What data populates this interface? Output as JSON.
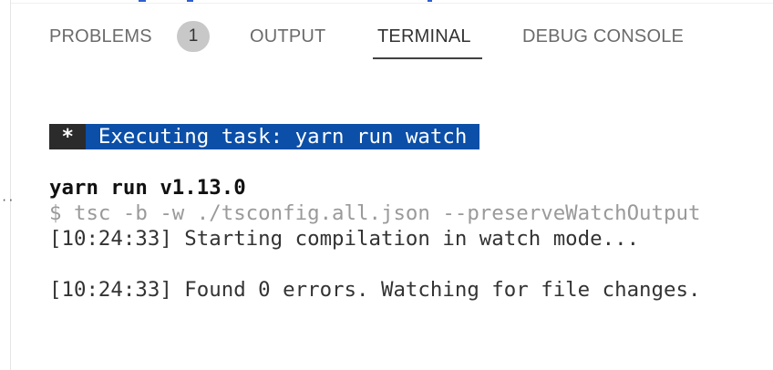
{
  "panel": {
    "tabs": [
      {
        "label": "PROBLEMS",
        "badge": "1"
      },
      {
        "label": "OUTPUT"
      },
      {
        "label": "TERMINAL",
        "active": true
      },
      {
        "label": "DEBUG CONSOLE"
      }
    ]
  },
  "gutter": {
    "ellipsis": "··"
  },
  "terminal": {
    "task_star": " * ",
    "task_text": " Executing task: yarn run watch ",
    "yarn_version": "yarn run v1.13.0",
    "command": "$ tsc -b -w ./tsconfig.all.json --preserveWatchOutput",
    "start_line": "[10:24:33] Starting compilation in watch mode...",
    "found_line": "[10:24:33] Found 0 errors. Watching for file changes."
  },
  "colors": {
    "accent_tab_underline": "#424242",
    "task_banner_blue": "#0b4fa8",
    "badge_gray": "#c8c8c8"
  }
}
